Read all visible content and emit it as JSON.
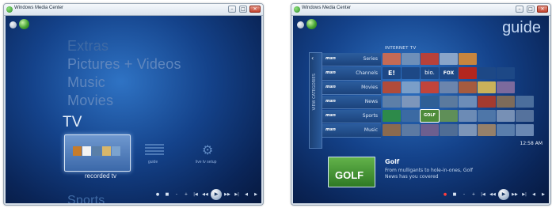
{
  "left_window": {
    "title": "Windows Media Center",
    "titlebar_buttons": [
      "–",
      "□",
      "✕"
    ],
    "menu": [
      "Extras",
      "Pictures + Videos",
      "Music",
      "Movies",
      "TV",
      "Sports"
    ],
    "strip": [
      {
        "label": "recorded tv",
        "selected": true
      },
      {
        "label": "guide",
        "selected": false
      },
      {
        "label": "live tv setup",
        "selected": false
      }
    ],
    "controls": [
      "●",
      "■",
      "–",
      "+",
      "|◀",
      "◀◀",
      "▶",
      "▶▶",
      "▶|",
      "◀",
      "▶"
    ],
    "icons": [
      "back-icon",
      "wmc-logo-icon",
      "gear-icon",
      "guide-icon"
    ]
  },
  "right_window": {
    "title": "Windows Media Center",
    "titlebar_buttons": [
      "–",
      "□",
      "✕"
    ],
    "header": "guide",
    "section_label": "INTERNET TV",
    "side_tab_label": "VIEW CATEGORIES",
    "categories": [
      {
        "brand": "msn",
        "name": "Series"
      },
      {
        "brand": "msn",
        "name": "Channels"
      },
      {
        "brand": "msn",
        "name": "Movies"
      },
      {
        "brand": "msn",
        "name": "News"
      },
      {
        "brand": "msn",
        "name": "Sports"
      },
      {
        "brand": "msn",
        "name": "Music"
      }
    ],
    "channel_logos": [
      "E!",
      "bio.",
      "FOX"
    ],
    "selected_tile_label": "GOLF",
    "time": "12:58 AM",
    "detail": {
      "title": "Golf",
      "description_line1": "From mulligants to hole-in-ones, Golf",
      "description_line2": "News has you covered",
      "art_label": "GOLF"
    },
    "controls": [
      "●",
      "■",
      "–",
      "+",
      "|◀",
      "◀◀",
      "▶",
      "▶▶",
      "▶|",
      "◀",
      "▶"
    ]
  },
  "colors": {
    "background": "#0a2558",
    "accent": "#2f73c4",
    "highlight_text": "#e9f1fb",
    "dim_text": "#5f86bd",
    "record_red": "#ff3d3d"
  }
}
